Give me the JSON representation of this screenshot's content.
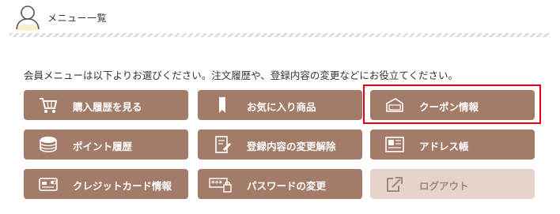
{
  "header": {
    "title": "メニュー一覧",
    "icon": "user-icon"
  },
  "intro_text": "会員メニューは以下よりお選びください。注文履歴や、登録内容の変更などにお役立てください。",
  "menu": [
    {
      "key": "purchase-history",
      "label": "購入履歴を見る",
      "icon": "cart-icon",
      "enabled": true
    },
    {
      "key": "favorites",
      "label": "お気に入り商品",
      "icon": "bookmark-icon",
      "enabled": true
    },
    {
      "key": "coupon",
      "label": "クーポン情報",
      "icon": "coupon-icon",
      "enabled": true,
      "highlighted": true
    },
    {
      "key": "points",
      "label": "ポイント履歴",
      "icon": "coins-icon",
      "enabled": true
    },
    {
      "key": "account-edit",
      "label": "登録内容の変更解除",
      "icon": "edit-document-icon",
      "enabled": true
    },
    {
      "key": "address-book",
      "label": "アドレス帳",
      "icon": "address-book-icon",
      "enabled": true
    },
    {
      "key": "credit-card",
      "label": "クレジットカード情報",
      "icon": "credit-card-icon",
      "enabled": true
    },
    {
      "key": "password",
      "label": "パスワードの変更",
      "icon": "password-lock-icon",
      "enabled": true
    },
    {
      "key": "logout",
      "label": "ログアウト",
      "icon": "logout-icon",
      "enabled": false
    }
  ],
  "colors": {
    "button": "#a37c69",
    "button_disabled": "#e6d3cc",
    "highlight": "#e60012"
  }
}
